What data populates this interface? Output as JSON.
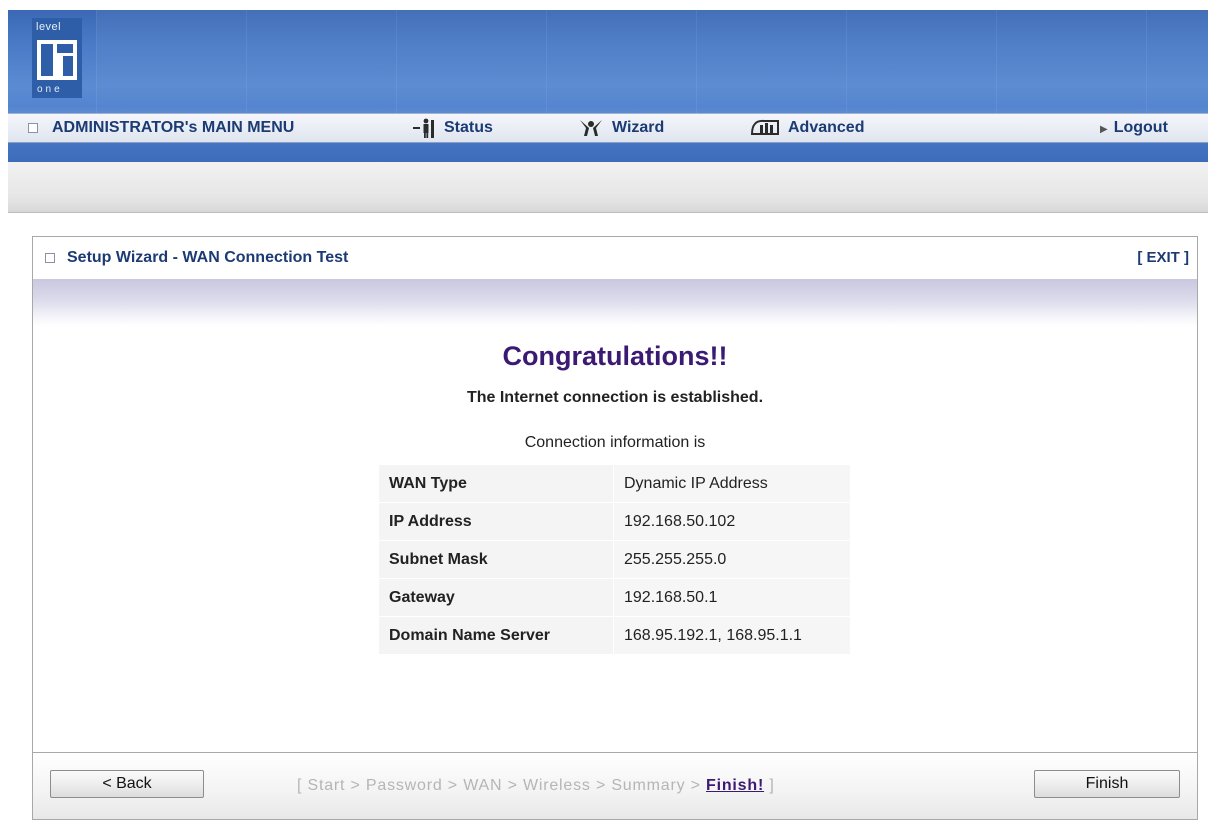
{
  "header": {
    "logo": {
      "top_text": "level",
      "bottom_text": "one"
    },
    "menu": {
      "main_label": "ADMINISTRATOR's MAIN MENU",
      "status_label": "Status",
      "wizard_label": "Wizard",
      "advanced_label": "Advanced",
      "logout_label": "Logout"
    }
  },
  "panel": {
    "title": "Setup Wizard - WAN Connection Test",
    "exit_label": "[ EXIT ]",
    "heading": "Congratulations!!",
    "message": "The Internet connection is established.",
    "info_caption": "Connection information is",
    "info_rows": [
      {
        "key": "WAN Type",
        "value": "Dynamic IP Address"
      },
      {
        "key": "IP Address",
        "value": "192.168.50.102"
      },
      {
        "key": "Subnet Mask",
        "value": "255.255.255.0"
      },
      {
        "key": "Gateway",
        "value": "192.168.50.1"
      },
      {
        "key": "Domain Name Server",
        "value": "168.95.192.1, 168.95.1.1"
      }
    ]
  },
  "footer": {
    "back_label": "< Back",
    "finish_label": "Finish",
    "steps_prefix": "[ Start > Password > WAN > Wireless > Summary > ",
    "steps_current": "Finish!",
    "steps_suffix": " ]"
  },
  "colors": {
    "header_blue": "#4a7ac6",
    "menu_text": "#1c3b74",
    "congrats_purple": "#3b1a73",
    "steps_gray": "#b5b5b5"
  },
  "icons": [
    "logo-mark",
    "status-icon",
    "wizard-icon",
    "advanced-icon",
    "square-bullet-icon",
    "triangle-right-icon"
  ]
}
